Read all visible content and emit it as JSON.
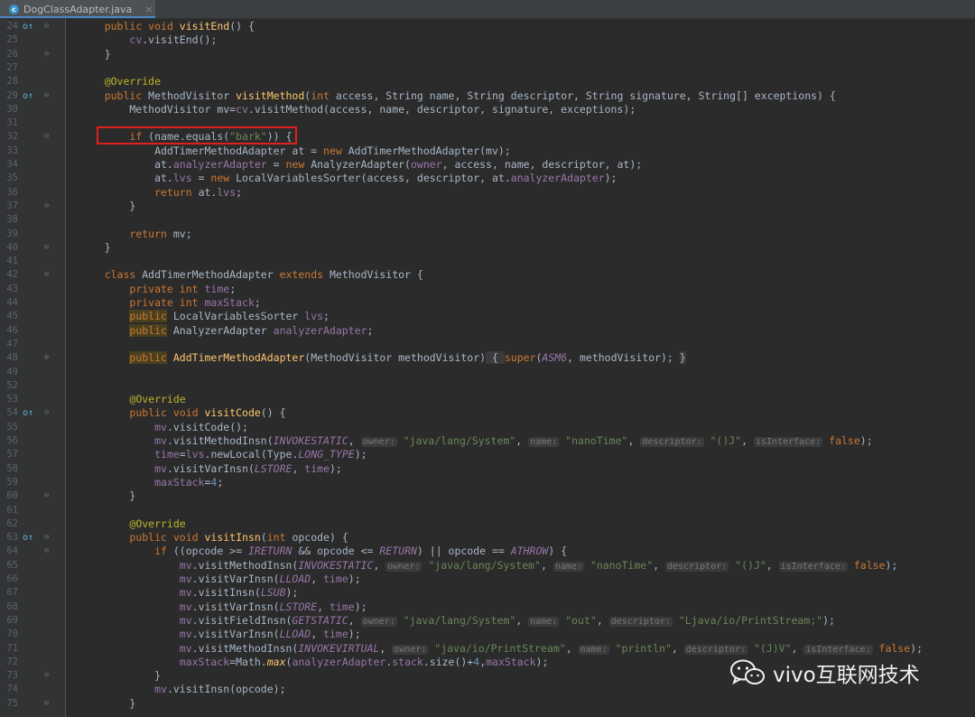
{
  "tab": {
    "filename": "DogClassAdapter.java",
    "file_icon_letter": "c",
    "close": "×"
  },
  "gutter_marker": "o↑",
  "lines": [
    {
      "n": "24",
      "mark": true,
      "fold": "⊖",
      "segs": [
        [
          "p",
          "    "
        ],
        [
          "kw",
          "public void "
        ],
        [
          "fn",
          "visitEnd"
        ],
        [
          "p",
          "() {"
        ]
      ]
    },
    {
      "n": "25",
      "segs": [
        [
          "p",
          "        "
        ],
        [
          "fd",
          "cv"
        ],
        [
          "p",
          ".visitEnd();"
        ]
      ]
    },
    {
      "n": "26",
      "fold": "⊖",
      "segs": [
        [
          "p",
          "    }"
        ]
      ]
    },
    {
      "n": "27",
      "segs": []
    },
    {
      "n": "28",
      "segs": [
        [
          "p",
          "    "
        ],
        [
          "an",
          "@Override"
        ]
      ]
    },
    {
      "n": "29",
      "mark": true,
      "fold": "⊖",
      "segs": [
        [
          "p",
          "    "
        ],
        [
          "kw",
          "public "
        ],
        [
          "p",
          "MethodVisitor "
        ],
        [
          "fn",
          "visitMethod"
        ],
        [
          "p",
          "("
        ],
        [
          "kw",
          "int "
        ],
        [
          "p",
          "access, String name, String descriptor, String signature, String[] exceptions) {"
        ]
      ]
    },
    {
      "n": "30",
      "segs": [
        [
          "p",
          "        MethodVisitor mv="
        ],
        [
          "fd",
          "cv"
        ],
        [
          "p",
          ".visitMethod(access, name, descriptor, signature, exceptions);"
        ]
      ]
    },
    {
      "n": "31",
      "segs": []
    },
    {
      "n": "32",
      "fold": "⊖",
      "segs": [
        [
          "p",
          "        "
        ],
        [
          "kw",
          "if "
        ],
        [
          "p",
          "(name.equals("
        ],
        [
          "st",
          "\"bark\""
        ],
        [
          "p",
          ")) {"
        ]
      ]
    },
    {
      "n": "33",
      "segs": [
        [
          "p",
          "            AddTimerMethodAdapter at = "
        ],
        [
          "kw",
          "new "
        ],
        [
          "p",
          "AddTimerMethodAdapter(mv);"
        ]
      ]
    },
    {
      "n": "34",
      "segs": [
        [
          "p",
          "            at."
        ],
        [
          "fd",
          "analyzerAdapter"
        ],
        [
          "p",
          " = "
        ],
        [
          "kw",
          "new "
        ],
        [
          "p",
          "AnalyzerAdapter("
        ],
        [
          "fd",
          "owner"
        ],
        [
          "p",
          ", access, name, descriptor, at);"
        ]
      ]
    },
    {
      "n": "35",
      "segs": [
        [
          "p",
          "            at."
        ],
        [
          "fd",
          "lvs"
        ],
        [
          "p",
          " = "
        ],
        [
          "kw",
          "new "
        ],
        [
          "p",
          "LocalVariablesSorter(access, descriptor, at."
        ],
        [
          "fd",
          "analyzerAdapter"
        ],
        [
          "p",
          ");"
        ]
      ]
    },
    {
      "n": "36",
      "segs": [
        [
          "p",
          "            "
        ],
        [
          "kw",
          "return "
        ],
        [
          "p",
          "at."
        ],
        [
          "fd",
          "lvs"
        ],
        [
          "p",
          ";"
        ]
      ]
    },
    {
      "n": "37",
      "fold": "⊖",
      "segs": [
        [
          "p",
          "        }"
        ]
      ]
    },
    {
      "n": "38",
      "segs": []
    },
    {
      "n": "39",
      "segs": [
        [
          "p",
          "        "
        ],
        [
          "kw",
          "return "
        ],
        [
          "p",
          "mv;"
        ]
      ]
    },
    {
      "n": "40",
      "fold": "⊖",
      "segs": [
        [
          "p",
          "    }"
        ]
      ]
    },
    {
      "n": "41",
      "segs": []
    },
    {
      "n": "42",
      "fold": "⊖",
      "segs": [
        [
          "p",
          "    "
        ],
        [
          "kw",
          "class "
        ],
        [
          "p",
          "AddTimerMethodAdapter "
        ],
        [
          "kw",
          "extends "
        ],
        [
          "p",
          "MethodVisitor {"
        ]
      ]
    },
    {
      "n": "43",
      "segs": [
        [
          "p",
          "        "
        ],
        [
          "kw",
          "private int "
        ],
        [
          "fd",
          "time"
        ],
        [
          "p",
          ";"
        ]
      ]
    },
    {
      "n": "44",
      "segs": [
        [
          "p",
          "        "
        ],
        [
          "kw",
          "private int "
        ],
        [
          "fd",
          "maxStack"
        ],
        [
          "p",
          ";"
        ]
      ]
    },
    {
      "n": "45",
      "segs": [
        [
          "p",
          "        "
        ],
        [
          "kwhl",
          "public"
        ],
        [
          "p",
          " LocalVariablesSorter "
        ],
        [
          "fd",
          "lvs"
        ],
        [
          "p",
          ";"
        ]
      ]
    },
    {
      "n": "46",
      "segs": [
        [
          "p",
          "        "
        ],
        [
          "kwhl",
          "public"
        ],
        [
          "p",
          " AnalyzerAdapter "
        ],
        [
          "fd",
          "analyzerAdapter"
        ],
        [
          "p",
          ";"
        ]
      ]
    },
    {
      "n": "47",
      "segs": []
    },
    {
      "n": "48",
      "fold": "⊕",
      "segs": [
        [
          "p",
          "        "
        ],
        [
          "kwhl",
          "public"
        ],
        [
          "p",
          " "
        ],
        [
          "fn",
          "AddTimerMethodAdapter"
        ],
        [
          "p",
          "(MethodVisitor methodVisitor)"
        ],
        [
          "fb",
          " { "
        ],
        [
          "kw",
          "super"
        ],
        [
          "p",
          "("
        ],
        [
          "cn",
          "ASM6"
        ],
        [
          "p",
          ", methodVisitor); "
        ],
        [
          "fb",
          "}"
        ]
      ]
    },
    {
      "n": "49",
      "segs": []
    },
    {
      "n": "52",
      "segs": []
    },
    {
      "n": "53",
      "segs": [
        [
          "p",
          "        "
        ],
        [
          "an",
          "@Override"
        ]
      ]
    },
    {
      "n": "54",
      "mark": true,
      "fold": "⊖",
      "segs": [
        [
          "p",
          "        "
        ],
        [
          "kw",
          "public void "
        ],
        [
          "fn",
          "visitCode"
        ],
        [
          "p",
          "() {"
        ]
      ]
    },
    {
      "n": "55",
      "segs": [
        [
          "p",
          "            "
        ],
        [
          "fd",
          "mv"
        ],
        [
          "p",
          ".visitCode();"
        ]
      ]
    },
    {
      "n": "56",
      "segs": [
        [
          "p",
          "            "
        ],
        [
          "fd",
          "mv"
        ],
        [
          "p",
          ".visitMethodInsn("
        ],
        [
          "cn",
          "INVOKESTATIC"
        ],
        [
          "p",
          ", "
        ],
        [
          "hint",
          "owner:"
        ],
        [
          "p",
          " "
        ],
        [
          "st",
          "\"java/lang/System\""
        ],
        [
          "p",
          ", "
        ],
        [
          "hint",
          "name:"
        ],
        [
          "p",
          " "
        ],
        [
          "st",
          "\"nanoTime\""
        ],
        [
          "p",
          ", "
        ],
        [
          "hint",
          "descriptor:"
        ],
        [
          "p",
          " "
        ],
        [
          "st",
          "\"()J\""
        ],
        [
          "p",
          ", "
        ],
        [
          "hint",
          "isInterface:"
        ],
        [
          "p",
          " "
        ],
        [
          "kw",
          "false"
        ],
        [
          "p",
          ");"
        ]
      ]
    },
    {
      "n": "57",
      "segs": [
        [
          "p",
          "            "
        ],
        [
          "fd",
          "time"
        ],
        [
          "p",
          "="
        ],
        [
          "fd",
          "lvs"
        ],
        [
          "p",
          ".newLocal(Type."
        ],
        [
          "cn",
          "LONG_TYPE"
        ],
        [
          "p",
          ");"
        ]
      ]
    },
    {
      "n": "58",
      "segs": [
        [
          "p",
          "            "
        ],
        [
          "fd",
          "mv"
        ],
        [
          "p",
          ".visitVarInsn("
        ],
        [
          "cn",
          "LSTORE"
        ],
        [
          "p",
          ", "
        ],
        [
          "fd",
          "time"
        ],
        [
          "p",
          ");"
        ]
      ]
    },
    {
      "n": "59",
      "segs": [
        [
          "p",
          "            "
        ],
        [
          "fd",
          "maxStack"
        ],
        [
          "p",
          "="
        ],
        [
          "nm",
          "4"
        ],
        [
          "p",
          ";"
        ]
      ]
    },
    {
      "n": "60",
      "fold": "⊖",
      "segs": [
        [
          "p",
          "        }"
        ]
      ]
    },
    {
      "n": "61",
      "segs": []
    },
    {
      "n": "62",
      "segs": [
        [
          "p",
          "        "
        ],
        [
          "an",
          "@Override"
        ]
      ]
    },
    {
      "n": "63",
      "mark": true,
      "fold": "⊖",
      "segs": [
        [
          "p",
          "        "
        ],
        [
          "kw",
          "public void "
        ],
        [
          "fn",
          "visitInsn"
        ],
        [
          "p",
          "("
        ],
        [
          "kw",
          "int "
        ],
        [
          "p",
          "opcode) {"
        ]
      ]
    },
    {
      "n": "64",
      "fold": "⊖",
      "segs": [
        [
          "p",
          "            "
        ],
        [
          "kw",
          "if "
        ],
        [
          "p",
          "((opcode >= "
        ],
        [
          "cn",
          "IRETURN"
        ],
        [
          "p",
          " && opcode <= "
        ],
        [
          "cn",
          "RETURN"
        ],
        [
          "p",
          ") || opcode == "
        ],
        [
          "cn",
          "ATHROW"
        ],
        [
          "p",
          ") {"
        ]
      ]
    },
    {
      "n": "65",
      "segs": [
        [
          "p",
          "                "
        ],
        [
          "fd",
          "mv"
        ],
        [
          "p",
          ".visitMethodInsn("
        ],
        [
          "cn",
          "INVOKESTATIC"
        ],
        [
          "p",
          ", "
        ],
        [
          "hint",
          "owner:"
        ],
        [
          "p",
          " "
        ],
        [
          "st",
          "\"java/lang/System\""
        ],
        [
          "p",
          ", "
        ],
        [
          "hint",
          "name:"
        ],
        [
          "p",
          " "
        ],
        [
          "st",
          "\"nanoTime\""
        ],
        [
          "p",
          ", "
        ],
        [
          "hint",
          "descriptor:"
        ],
        [
          "p",
          " "
        ],
        [
          "st",
          "\"()J\""
        ],
        [
          "p",
          ", "
        ],
        [
          "hint",
          "isInterface:"
        ],
        [
          "p",
          " "
        ],
        [
          "kw",
          "false"
        ],
        [
          "p",
          ");"
        ]
      ]
    },
    {
      "n": "66",
      "segs": [
        [
          "p",
          "                "
        ],
        [
          "fd",
          "mv"
        ],
        [
          "p",
          ".visitVarInsn("
        ],
        [
          "cn",
          "LLOAD"
        ],
        [
          "p",
          ", "
        ],
        [
          "fd",
          "time"
        ],
        [
          "p",
          ");"
        ]
      ]
    },
    {
      "n": "67",
      "segs": [
        [
          "p",
          "                "
        ],
        [
          "fd",
          "mv"
        ],
        [
          "p",
          ".visitInsn("
        ],
        [
          "cn",
          "LSUB"
        ],
        [
          "p",
          ");"
        ]
      ]
    },
    {
      "n": "68",
      "segs": [
        [
          "p",
          "                "
        ],
        [
          "fd",
          "mv"
        ],
        [
          "p",
          ".visitVarInsn("
        ],
        [
          "cn",
          "LSTORE"
        ],
        [
          "p",
          ", "
        ],
        [
          "fd",
          "time"
        ],
        [
          "p",
          ");"
        ]
      ]
    },
    {
      "n": "69",
      "segs": [
        [
          "p",
          "                "
        ],
        [
          "fd",
          "mv"
        ],
        [
          "p",
          ".visitFieldInsn("
        ],
        [
          "cn",
          "GETSTATIC"
        ],
        [
          "p",
          ", "
        ],
        [
          "hint",
          "owner:"
        ],
        [
          "p",
          " "
        ],
        [
          "st",
          "\"java/lang/System\""
        ],
        [
          "p",
          ", "
        ],
        [
          "hint",
          "name:"
        ],
        [
          "p",
          " "
        ],
        [
          "st",
          "\"out\""
        ],
        [
          "p",
          ", "
        ],
        [
          "hint",
          "descriptor:"
        ],
        [
          "p",
          " "
        ],
        [
          "st",
          "\"Ljava/io/PrintStream;\""
        ],
        [
          "p",
          ");"
        ]
      ]
    },
    {
      "n": "70",
      "segs": [
        [
          "p",
          "                "
        ],
        [
          "fd",
          "mv"
        ],
        [
          "p",
          ".visitVarInsn("
        ],
        [
          "cn",
          "LLOAD"
        ],
        [
          "p",
          ", "
        ],
        [
          "fd",
          "time"
        ],
        [
          "p",
          ");"
        ]
      ]
    },
    {
      "n": "71",
      "segs": [
        [
          "p",
          "                "
        ],
        [
          "fd",
          "mv"
        ],
        [
          "p",
          ".visitMethodInsn("
        ],
        [
          "cn",
          "INVOKEVIRTUAL"
        ],
        [
          "p",
          ", "
        ],
        [
          "hint",
          "owner:"
        ],
        [
          "p",
          " "
        ],
        [
          "st",
          "\"java/io/PrintStream\""
        ],
        [
          "p",
          ", "
        ],
        [
          "hint",
          "name:"
        ],
        [
          "p",
          " "
        ],
        [
          "st",
          "\"println\""
        ],
        [
          "p",
          ", "
        ],
        [
          "hint",
          "descriptor:"
        ],
        [
          "p",
          " "
        ],
        [
          "st",
          "\"(J)V\""
        ],
        [
          "p",
          ", "
        ],
        [
          "hint",
          "isInterface:"
        ],
        [
          "p",
          " "
        ],
        [
          "kw",
          "false"
        ],
        [
          "p",
          ");"
        ]
      ]
    },
    {
      "n": "72",
      "segs": [
        [
          "p",
          "                "
        ],
        [
          "fd",
          "maxStack"
        ],
        [
          "p",
          "=Math."
        ],
        [
          "fnit",
          "max"
        ],
        [
          "p",
          "("
        ],
        [
          "fd",
          "analyzerAdapter"
        ],
        [
          "p",
          "."
        ],
        [
          "fd",
          "stack"
        ],
        [
          "p",
          ".size()+"
        ],
        [
          "nm",
          "4"
        ],
        [
          "p",
          ","
        ],
        [
          "fd",
          "maxStack"
        ],
        [
          "p",
          ");"
        ]
      ]
    },
    {
      "n": "73",
      "fold": "⊖",
      "segs": [
        [
          "p",
          "            }"
        ]
      ]
    },
    {
      "n": "74",
      "segs": [
        [
          "p",
          "            "
        ],
        [
          "fd",
          "mv"
        ],
        [
          "p",
          ".visitInsn(opcode);"
        ]
      ]
    },
    {
      "n": "75",
      "fold": "⊖",
      "segs": [
        [
          "p",
          "        }"
        ]
      ]
    }
  ],
  "watermark": {
    "text": "vivo互联网技术"
  },
  "colors": {
    "keyword": "#cc7832",
    "method": "#ffc66d",
    "annotation": "#bbb529",
    "string": "#6a8759",
    "field": "#9876aa",
    "number": "#6897bb",
    "highlight_box": "#e02020"
  }
}
